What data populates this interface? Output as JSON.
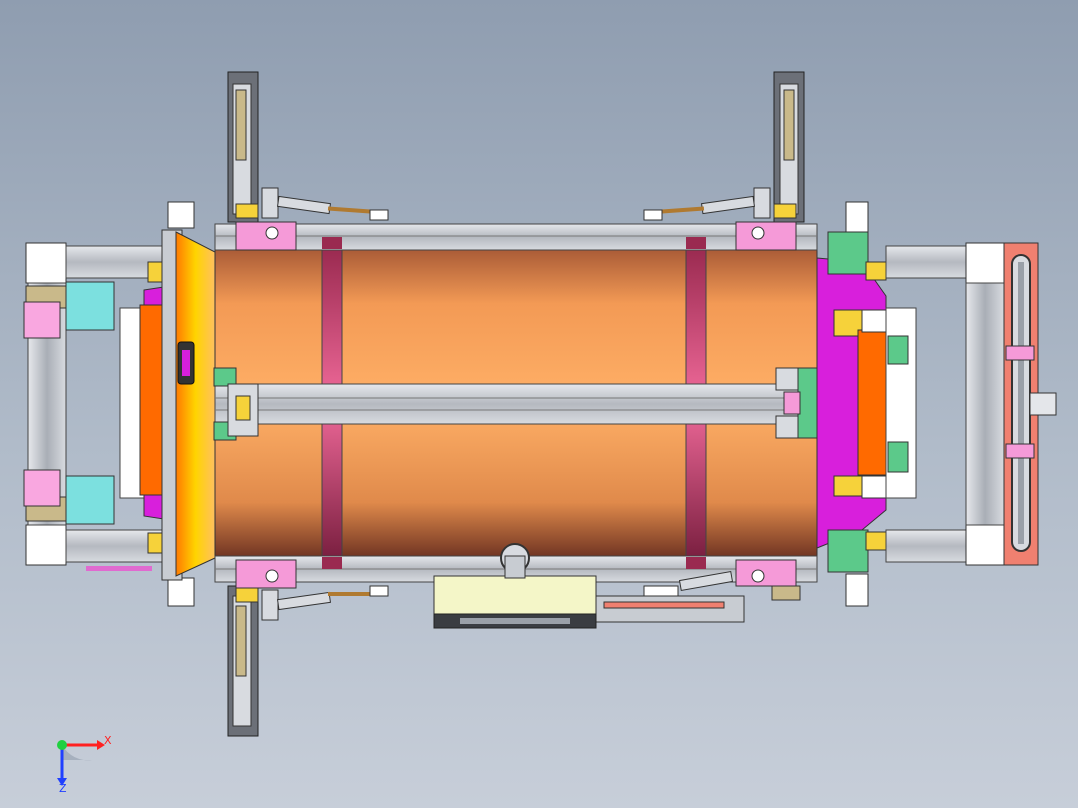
{
  "viewport": {
    "background_top": "#8f9db0",
    "background_bottom": "#c7ced9"
  },
  "model": {
    "drum_color": "#f29a52",
    "band_color": "#e0578a",
    "frame_color": "#c8ccd2",
    "clamp_color": "#7ce0df",
    "pink_color": "#f59ad8",
    "magenta_color": "#d81fdc",
    "orange_color": "#ff6a00",
    "yellow_color": "#f6d23a",
    "green_color": "#5cc98a",
    "salmon_color": "#f08070"
  },
  "triad": {
    "x_label": "X",
    "z_label": "Z",
    "x_color": "#ff2020",
    "y_color": "#20d040",
    "z_color": "#2040ff"
  }
}
